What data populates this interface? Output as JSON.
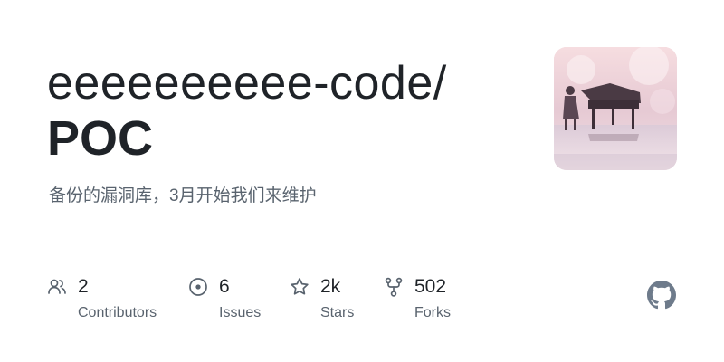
{
  "repo_card": {
    "owner": "eeeeeeeeee-code/",
    "name": "POC",
    "description": "备份的漏洞库，3月开始我们来维护",
    "avatar_icon": "piano-scene-avatar"
  },
  "stats": [
    {
      "icon": "people-icon",
      "value": "2",
      "label": "Contributors"
    },
    {
      "icon": "issue-icon",
      "value": "6",
      "label": "Issues"
    },
    {
      "icon": "star-icon",
      "value": "2k",
      "label": "Stars"
    },
    {
      "icon": "fork-icon",
      "value": "502",
      "label": "Forks"
    }
  ],
  "brand": {
    "logo_icon": "github-logo-icon",
    "logo_color": "#6e7b8b"
  },
  "colors": {
    "text_primary": "#1f2328",
    "text_secondary": "#59636e",
    "icon_color": "#59636e"
  }
}
